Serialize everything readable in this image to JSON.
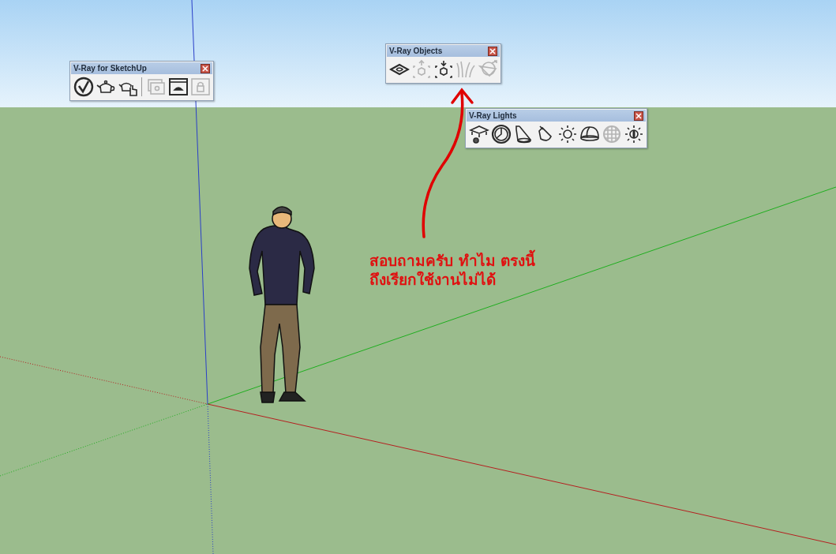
{
  "toolbars": [
    {
      "title": "V-Ray for SketchUp",
      "buttons": [
        {
          "kind": "logo",
          "disabled": false
        },
        {
          "kind": "teapot",
          "disabled": false
        },
        {
          "kind": "teapothand",
          "disabled": false
        },
        {
          "kind": "sep"
        },
        {
          "kind": "frames",
          "disabled": true
        },
        {
          "kind": "framebuffer",
          "disabled": false
        },
        {
          "kind": "lock",
          "disabled": true
        }
      ]
    },
    {
      "title": "V-Ray Objects",
      "buttons": [
        {
          "kind": "plane",
          "disabled": false
        },
        {
          "kind": "boxup",
          "disabled": true
        },
        {
          "kind": "boxdown",
          "disabled": false
        },
        {
          "kind": "grass",
          "disabled": true
        },
        {
          "kind": "meshclip",
          "disabled": true
        }
      ]
    },
    {
      "title": "V-Ray Lights",
      "buttons": [
        {
          "kind": "rectlight",
          "disabled": false
        },
        {
          "kind": "spherelight",
          "disabled": false
        },
        {
          "kind": "spot",
          "disabled": false
        },
        {
          "kind": "ies",
          "disabled": false
        },
        {
          "kind": "omni",
          "disabled": false
        },
        {
          "kind": "dome",
          "disabled": false
        },
        {
          "kind": "meshlight",
          "disabled": true
        },
        {
          "kind": "sun",
          "disabled": false
        }
      ]
    }
  ],
  "annotation": [
    "สอบถามครับ ทำไม ตรงนี้",
    "ถึงเรียกใช้งานไม่ได้"
  ]
}
